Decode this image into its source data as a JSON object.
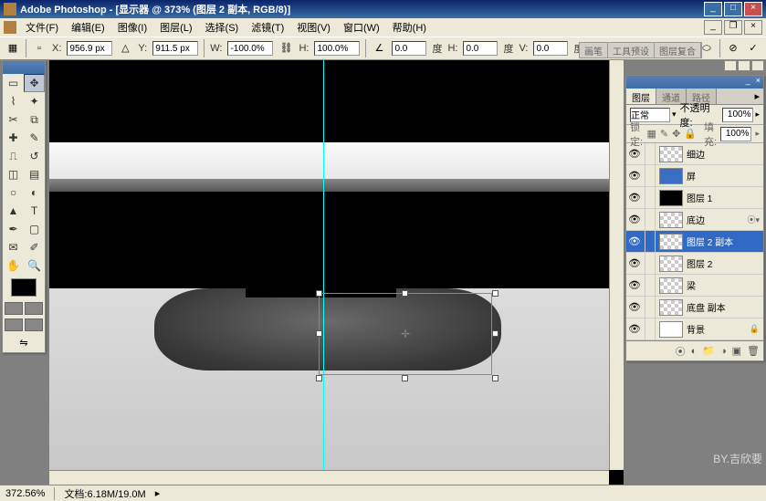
{
  "window": {
    "title": "Adobe Photoshop - [显示器 @ 373% (图层 2 副本, RGB/8)]"
  },
  "menu": {
    "file": "文件(F)",
    "edit": "编辑(E)",
    "image": "图像(I)",
    "layer": "图层(L)",
    "select": "选择(S)",
    "filter": "滤镜(T)",
    "view": "视图(V)",
    "window": "窗口(W)",
    "help": "帮助(H)"
  },
  "options": {
    "x_label": "X:",
    "x": "956.9 px",
    "y_label": "Y:",
    "y": "911.5 px",
    "w_label": "W:",
    "w": "-100.0%",
    "h_label": "H:",
    "h": "100.0%",
    "angle_label": "",
    "angle": "0.0",
    "angle_unit": "度",
    "hskew_label": "H:",
    "hskew": "0.0",
    "hskew_unit": "度",
    "vskew_label": "V:",
    "vskew": "0.0",
    "vskew_unit": "度"
  },
  "presets": {
    "brush": "画笔",
    "tool": "工具预设",
    "comp": "图层复合"
  },
  "layers_panel": {
    "tab_layers": "图层",
    "tab_channels": "通道",
    "tab_paths": "路径",
    "blend": "正常",
    "opacity_label": "不透明度:",
    "opacity": "100%",
    "lock_label": "锁定:",
    "fill_label": "填充:",
    "fill": "100%",
    "items": [
      {
        "name": "细边",
        "thumb": "checker"
      },
      {
        "name": "屏",
        "thumb": "blue"
      },
      {
        "name": "图层 1",
        "thumb": "black"
      },
      {
        "name": "底边",
        "thumb": "checker",
        "fx": true
      },
      {
        "name": "图层 2 副本",
        "thumb": "checker",
        "selected": true
      },
      {
        "name": "图层 2",
        "thumb": "checker"
      },
      {
        "name": "梁",
        "thumb": "checker"
      },
      {
        "name": "底盘 副本",
        "thumb": "checker"
      },
      {
        "name": "背景",
        "thumb": "white",
        "locked": true
      }
    ]
  },
  "status": {
    "zoom": "372.56%",
    "doc_label": "文档:",
    "doc": "6.18M/19.0M"
  },
  "watermark": "BY.吉欣要"
}
